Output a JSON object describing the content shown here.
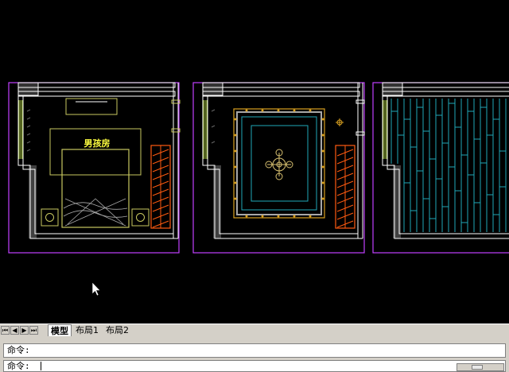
{
  "drawing": {
    "room_label": "男孩房",
    "colors": {
      "background": "#000000",
      "wall": "#ffffff",
      "frame": "#c040ff",
      "furniture": "#c8c860",
      "wardrobe": "#ff5a10",
      "floor": "#20a8b8",
      "gold": "#d8a020",
      "green": "#a8c840"
    }
  },
  "cursor": {
    "icon": "arrow-cursor-icon"
  },
  "tabs": {
    "nav_icons": [
      "first-icon",
      "prev-icon",
      "next-icon",
      "last-icon"
    ],
    "items": [
      {
        "label": "模型",
        "active": true
      },
      {
        "label": "布局1",
        "active": false
      },
      {
        "label": "布局2",
        "active": false
      }
    ]
  },
  "command": {
    "history_prompt": "命令:",
    "input_prompt": "命令:"
  }
}
